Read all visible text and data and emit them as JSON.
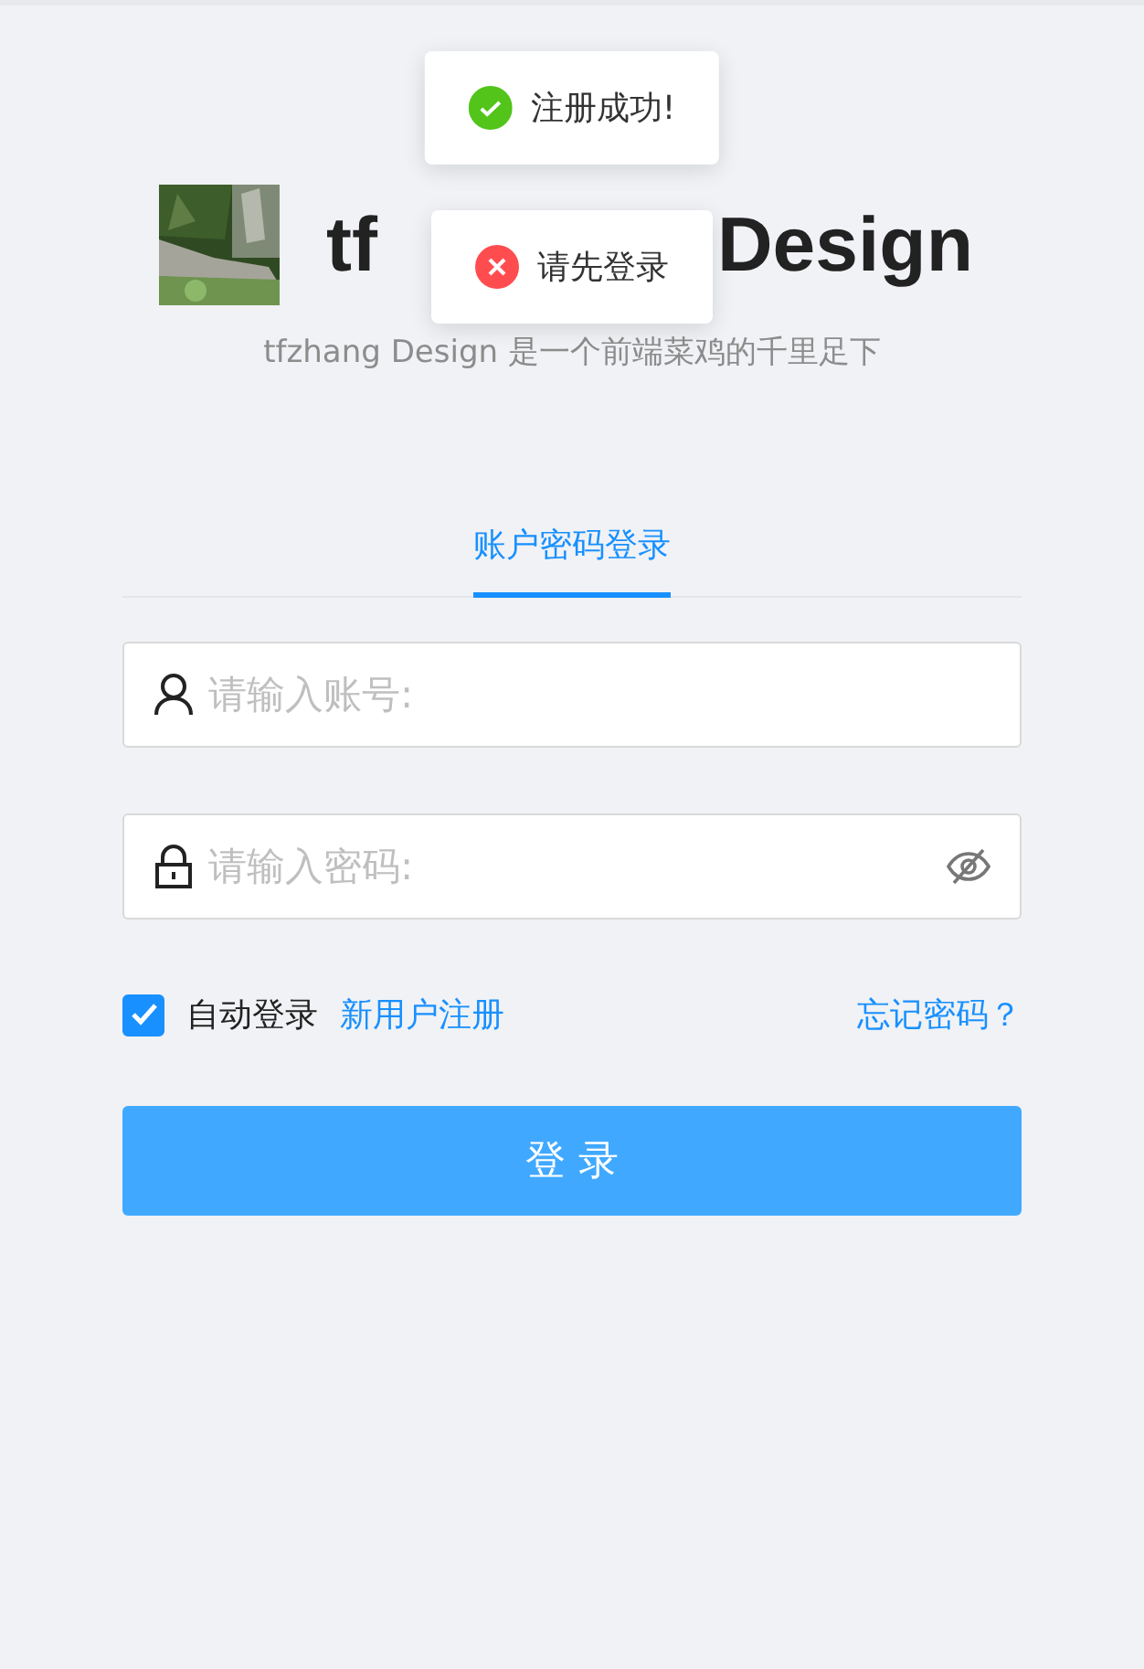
{
  "messages": [
    {
      "kind": "success",
      "text": "注册成功!"
    },
    {
      "kind": "error",
      "text": "请先登录"
    }
  ],
  "header": {
    "title_parts": [
      "tf",
      "Design"
    ],
    "subtitle": "tfzhang Design 是一个前端菜鸡的千里足下"
  },
  "tabs": [
    {
      "label": "账户密码登录",
      "selected": true
    }
  ],
  "fields": [
    {
      "kind": "user",
      "placeholder": "请输入账号:"
    },
    {
      "kind": "password",
      "placeholder": "请输入密码:"
    }
  ],
  "remember": {
    "label": "自动登录",
    "checked": true
  },
  "register_link": "新用户注册",
  "forgot_link": "忘记密码？",
  "submit": "登 录"
}
